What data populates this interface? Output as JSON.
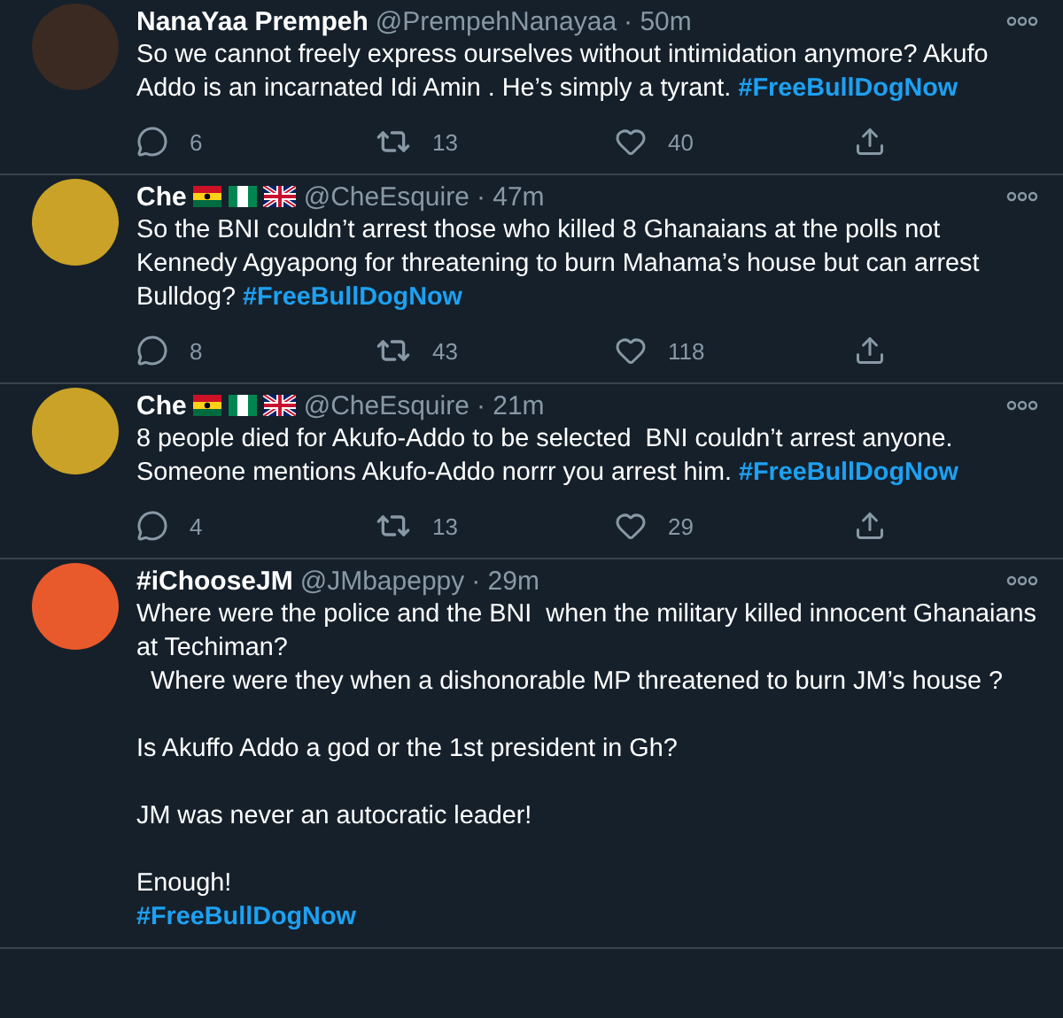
{
  "tweets": [
    {
      "name": "NanaYaa Prempeh",
      "flag_badges": false,
      "handle": "@PrempehNanayaa",
      "time": "· 50m",
      "text": "So we cannot freely express ourselves without intimidation anymore? Akufo Addo is an incarnated Idi Amin . He’s simply a tyrant. ",
      "hashtag": "#FreeBullDogNow",
      "stats": {
        "replies": "6",
        "retweets": "13",
        "likes": "40"
      }
    },
    {
      "name": "Che",
      "flag_badges": true,
      "handle": "@CheEsquire",
      "time": "· 47m",
      "text": "So the BNI couldn’t arrest those who killed 8 Ghanaians at the polls not Kennedy Agyapong for threatening to burn Mahama’s house but can arrest Bulldog? ",
      "hashtag": "#FreeBullDogNow",
      "stats": {
        "replies": "8",
        "retweets": "43",
        "likes": "118"
      }
    },
    {
      "name": "Che",
      "flag_badges": true,
      "handle": "@CheEsquire",
      "time": "· 21m",
      "text": "8 people died for Akufo-Addo to be selected  BNI couldn’t arrest anyone.\nSomeone mentions Akufo-Addo norrr you arrest him. ",
      "hashtag": "#FreeBullDogNow",
      "stats": {
        "replies": "4",
        "retweets": "13",
        "likes": "29"
      }
    },
    {
      "name": "#iChooseJM",
      "flag_badges": false,
      "handle": "@JMbapeppy",
      "time": "· 29m",
      "text": "Where were the police and the BNI  when the military killed innocent Ghanaians at Techiman?\n  Where were they when a dishonorable MP threatened to burn JM’s house ?\n\nIs Akuffo Addo a god or the 1st president in Gh?\n\nJM was never an autocratic leader!\n\nEnough!\n",
      "hashtag": "#FreeBullDogNow"
    }
  ]
}
